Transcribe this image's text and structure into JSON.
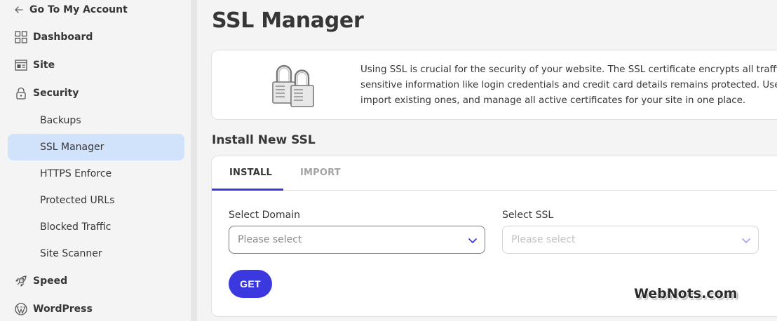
{
  "sidebar": {
    "back_label": "Go To My Account",
    "items": [
      {
        "label": "Dashboard",
        "icon": "grid-icon"
      },
      {
        "label": "Site",
        "icon": "site-layout-icon"
      },
      {
        "label": "Security",
        "icon": "lock-icon"
      }
    ],
    "security_subitems": [
      {
        "label": "Backups",
        "active": false
      },
      {
        "label": "SSL Manager",
        "active": true
      },
      {
        "label": "HTTPS Enforce",
        "active": false
      },
      {
        "label": "Protected URLs",
        "active": false
      },
      {
        "label": "Blocked Traffic",
        "active": false
      },
      {
        "label": "Site Scanner",
        "active": false
      }
    ],
    "bottom_items": [
      {
        "label": "Speed",
        "icon": "rocket-icon"
      },
      {
        "label": "WordPress",
        "icon": "wordpress-icon"
      }
    ]
  },
  "main": {
    "title": "SSL Manager",
    "info": {
      "line1": "Using SSL is crucial for the security of your website. The SSL certificate encrypts all traffic",
      "line2": "sensitive information like login credentials and credit card details remains protected. Use t",
      "line3": "import existing ones, and manage all active certificates for your site in one place."
    },
    "section_title": "Install New SSL",
    "tabs": [
      {
        "label": "INSTALL",
        "active": true
      },
      {
        "label": "IMPORT",
        "active": false
      }
    ],
    "fields": {
      "domain": {
        "label": "Select Domain",
        "placeholder": "Please select"
      },
      "ssl": {
        "label": "Select SSL",
        "placeholder": "Please select"
      }
    },
    "get_button": "GET"
  },
  "watermark": "WebNots.com",
  "colors": {
    "accent": "#3c38e0",
    "active_nav_bg": "#d1e2fb",
    "page_bg": "#f4f4f4"
  }
}
